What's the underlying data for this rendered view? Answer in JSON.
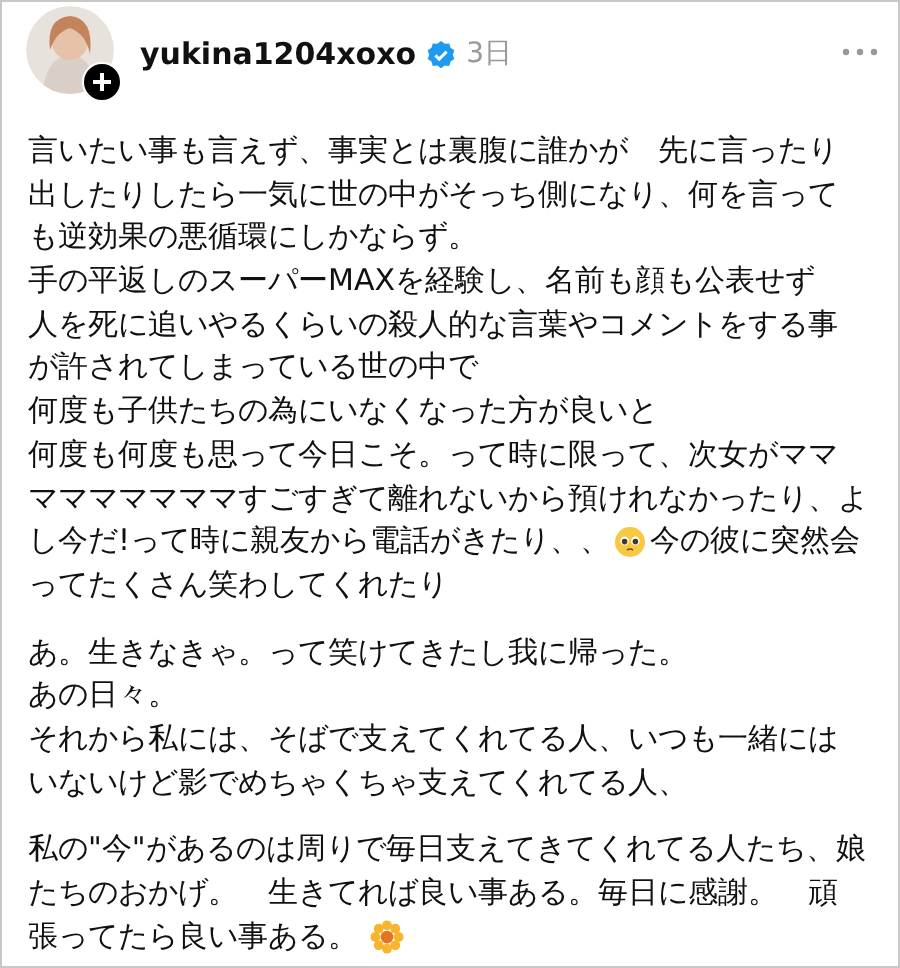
{
  "post": {
    "username": "yukina1204xoxo",
    "verified": true,
    "time": "3日",
    "paragraphs": [
      [
        [
          {
            "kind": "text",
            "text": "言いたい事も言えず、事実とは裏腹に誰かが　先に言ったり"
          }
        ],
        [
          {
            "kind": "text",
            "text": "出したりしたら一気に世の中がそっち側になり、何を言って"
          }
        ],
        [
          {
            "kind": "text",
            "text": "も逆効果の悪循環にしかならず。"
          }
        ],
        [
          {
            "kind": "text",
            "text": "手の平返しのスーパーMAXを経験し、名前も顔も公表せず"
          }
        ],
        [
          {
            "kind": "text",
            "text": "人を死に追いやるくらいの殺人的な言葉やコメントをする事"
          }
        ],
        [
          {
            "kind": "text",
            "text": "が許されてしまっている世の中で"
          }
        ],
        [
          {
            "kind": "text",
            "text": "何度も子供たちの為にいなくなった方が良いと"
          }
        ],
        [
          {
            "kind": "text",
            "text": "何度も何度も思って今日こそ。って時に限って、次女がママ"
          }
        ],
        [
          {
            "kind": "text",
            "text": "マママママママすごすぎて離れないから預けれなかったり、よ"
          }
        ],
        [
          {
            "kind": "text",
            "text": "し今だ!って時に親友から電話がきたり、、"
          },
          {
            "kind": "face"
          },
          {
            "kind": "text",
            "text": "今の彼に突然会"
          }
        ],
        [
          {
            "kind": "text",
            "text": "ってたくさん笑わしてくれたり"
          }
        ]
      ],
      [
        [
          {
            "kind": "text",
            "text": "あ。生きなきゃ。って笑けてきたし我に帰った。"
          }
        ],
        [
          {
            "kind": "text",
            "text": "あの日々。"
          }
        ],
        [
          {
            "kind": "text",
            "text": "それから私には、そばで支えてくれてる人、いつも一緒には"
          }
        ],
        [
          {
            "kind": "text",
            "text": "いないけど影でめちゃくちゃ支えてくれてる人、"
          }
        ]
      ],
      [
        [
          {
            "kind": "text",
            "text": "私の\"今\"があるのは周りで毎日支えてきてくれてる人たち、娘"
          }
        ],
        [
          {
            "kind": "text",
            "text": "たちのおかげ。　生きてれば良い事ある。毎日に感謝。　頑"
          }
        ],
        [
          {
            "kind": "text",
            "text": "張ってたら良い事ある。"
          },
          {
            "kind": "flower"
          }
        ]
      ]
    ]
  }
}
